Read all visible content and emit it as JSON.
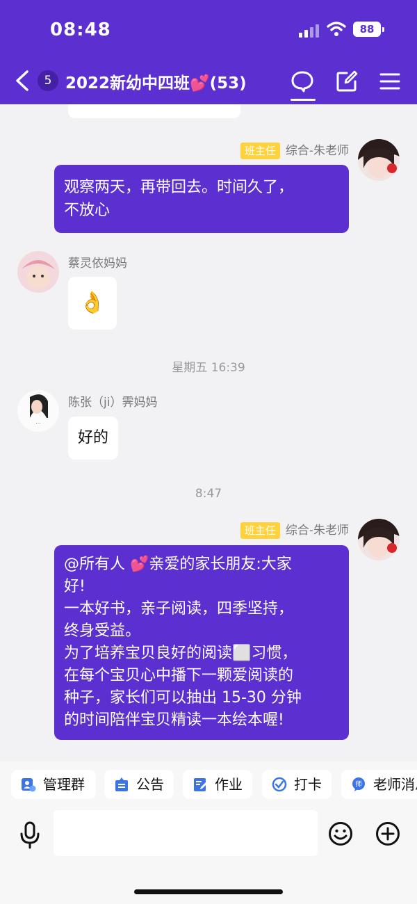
{
  "status_bar": {
    "time": "08:48",
    "battery": "88"
  },
  "nav": {
    "unread_count": "5",
    "title": "2022新幼中四班",
    "title_heart": "💕",
    "member_count": "(53)"
  },
  "messages": [
    {
      "type": "self",
      "role": "班主任",
      "sender": "综合-朱老师",
      "lines": [
        "观察两天，再带回去。时间久了，",
        "不放心"
      ]
    },
    {
      "type": "other",
      "sender": "蔡灵依妈妈",
      "text": "👌"
    },
    {
      "type": "time",
      "text": "星期五 16:39"
    },
    {
      "type": "other",
      "sender": "陈张（ji）霁妈妈",
      "text": "好的"
    },
    {
      "type": "time",
      "text": "8:47"
    },
    {
      "type": "self",
      "role": "班主任",
      "sender": "综合-朱老师",
      "lines": [
        "@所有人 💕亲爱的家长朋友:大家",
        "好!",
        "一本好书，亲子阅读，四季坚持，",
        "终身受益。",
        "为了培养宝贝良好的阅读⬜习惯，",
        "在每个宝贝心中播下一颗爱阅读的",
        "种子，家长们可以抽出 15-30 分钟",
        "的时间陪伴宝贝精读一本绘本喔!"
      ]
    }
  ],
  "quick_actions": [
    "管理群",
    "公告",
    "作业",
    "打卡",
    "老师消息"
  ],
  "input": {
    "placeholder": ""
  },
  "colors": {
    "accent": "#5b2fd0",
    "badge": "#ffd23c"
  }
}
